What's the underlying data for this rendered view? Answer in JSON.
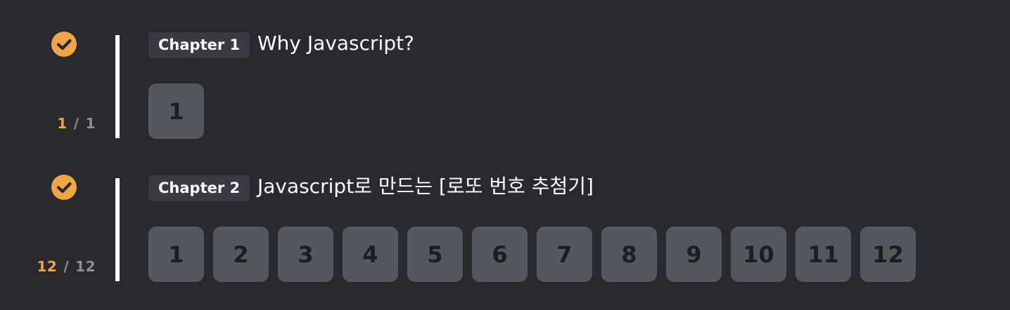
{
  "chapters": [
    {
      "tag": "Chapter 1",
      "title": "Why Javascript?",
      "completed": "1",
      "total": "1",
      "separator": "/",
      "lessons": [
        "1"
      ]
    },
    {
      "tag": "Chapter 2",
      "title": "Javascript로 만드는 [로또 번호 추첨기]",
      "completed": "12",
      "total": "12",
      "separator": "/",
      "lessons": [
        "1",
        "2",
        "3",
        "4",
        "5",
        "6",
        "7",
        "8",
        "9",
        "10",
        "11",
        "12"
      ]
    }
  ],
  "colors": {
    "background": "#292a2f",
    "accent": "#f0a542",
    "tag_bg": "#3a3b42",
    "lesson_bg": "#55575e",
    "lesson_text": "#1d1e22"
  },
  "icons": {
    "status": "check-circle-icon"
  }
}
